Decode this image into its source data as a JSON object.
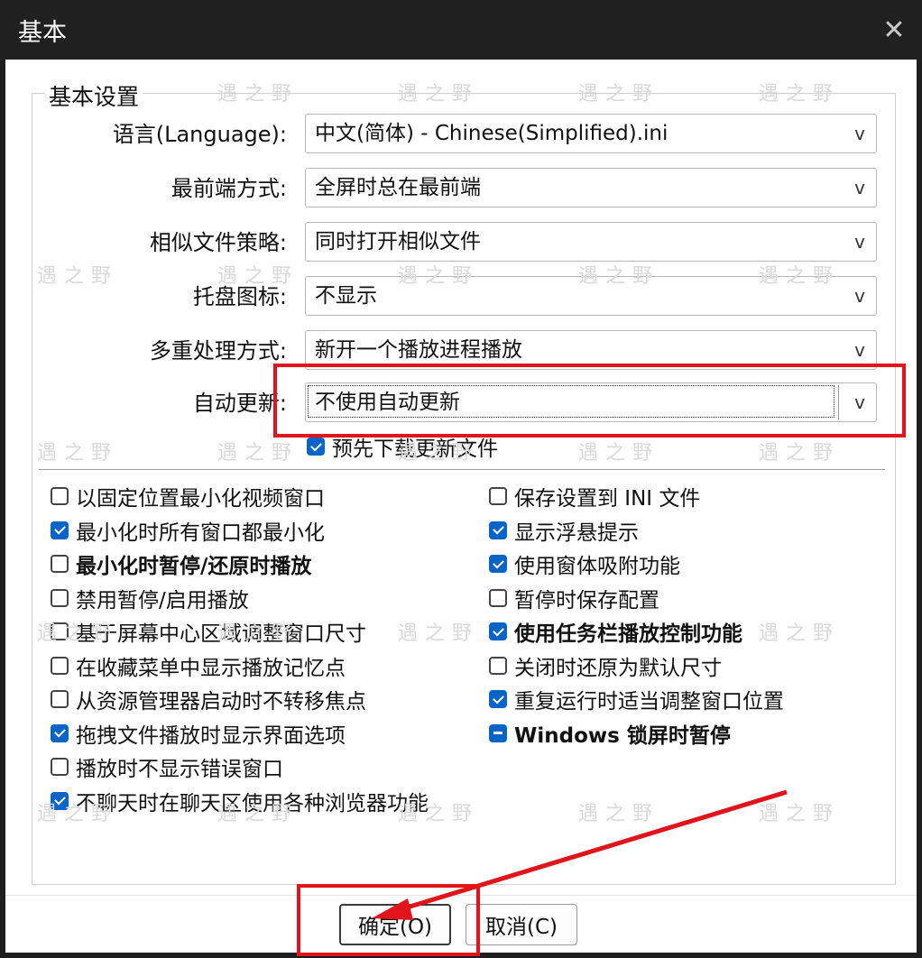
{
  "window": {
    "title": "基本",
    "close_glyph": "✕"
  },
  "group": {
    "legend": "基本设置"
  },
  "settings": [
    {
      "label": "语言(Language):",
      "value": "中文(简体) - Chinese(Simplified).ini"
    },
    {
      "label": "最前端方式:",
      "value": "全屏时总在最前端"
    },
    {
      "label": "相似文件策略:",
      "value": "同时打开相似文件"
    },
    {
      "label": "托盘图标:",
      "value": "不显示"
    },
    {
      "label": "多重处理方式:",
      "value": "新开一个播放进程播放"
    },
    {
      "label": "自动更新:",
      "value": "不使用自动更新"
    }
  ],
  "dropdown_glyph": "v",
  "predownload": {
    "label": "预先下载更新文件",
    "state": "checked"
  },
  "left_options": [
    {
      "label": "以固定位置最小化视频窗口",
      "state": "unchecked",
      "bold": false
    },
    {
      "label": "最小化时所有窗口都最小化",
      "state": "checked",
      "bold": false
    },
    {
      "label": "最小化时暂停/还原时播放",
      "state": "unchecked",
      "bold": true
    },
    {
      "label": "禁用暂停/启用播放",
      "state": "unchecked",
      "bold": false
    },
    {
      "label": "基于屏幕中心区域调整窗口尺寸",
      "state": "unchecked",
      "bold": false
    },
    {
      "label": "在收藏菜单中显示播放记忆点",
      "state": "unchecked",
      "bold": false
    },
    {
      "label": "从资源管理器启动时不转移焦点",
      "state": "unchecked",
      "bold": false
    },
    {
      "label": "拖拽文件播放时显示界面选项",
      "state": "checked",
      "bold": false
    },
    {
      "label": "播放时不显示错误窗口",
      "state": "unchecked",
      "bold": false
    },
    {
      "label": "不聊天时在聊天区使用各种浏览器功能",
      "state": "checked",
      "bold": false
    }
  ],
  "right_options": [
    {
      "label": "保存设置到 INI 文件",
      "state": "unchecked",
      "bold": false
    },
    {
      "label": "显示浮悬提示",
      "state": "checked",
      "bold": false
    },
    {
      "label": "使用窗体吸附功能",
      "state": "checked",
      "bold": false
    },
    {
      "label": "暂停时保存配置",
      "state": "unchecked",
      "bold": false
    },
    {
      "label": "使用任务栏播放控制功能",
      "state": "checked",
      "bold": true
    },
    {
      "label": "关闭时还原为默认尺寸",
      "state": "unchecked",
      "bold": false
    },
    {
      "label": "重复运行时适当调整窗口位置",
      "state": "checked",
      "bold": false
    },
    {
      "label": "Windows 锁屏时暂停",
      "state": "indeterminate",
      "bold": true
    }
  ],
  "buttons": {
    "ok": "确定(O)",
    "cancel": "取消(C)"
  },
  "watermark": "遇之野",
  "colors": {
    "accent": "#0a64c8",
    "highlight": "#e0141a",
    "titlebar": "#202020"
  }
}
